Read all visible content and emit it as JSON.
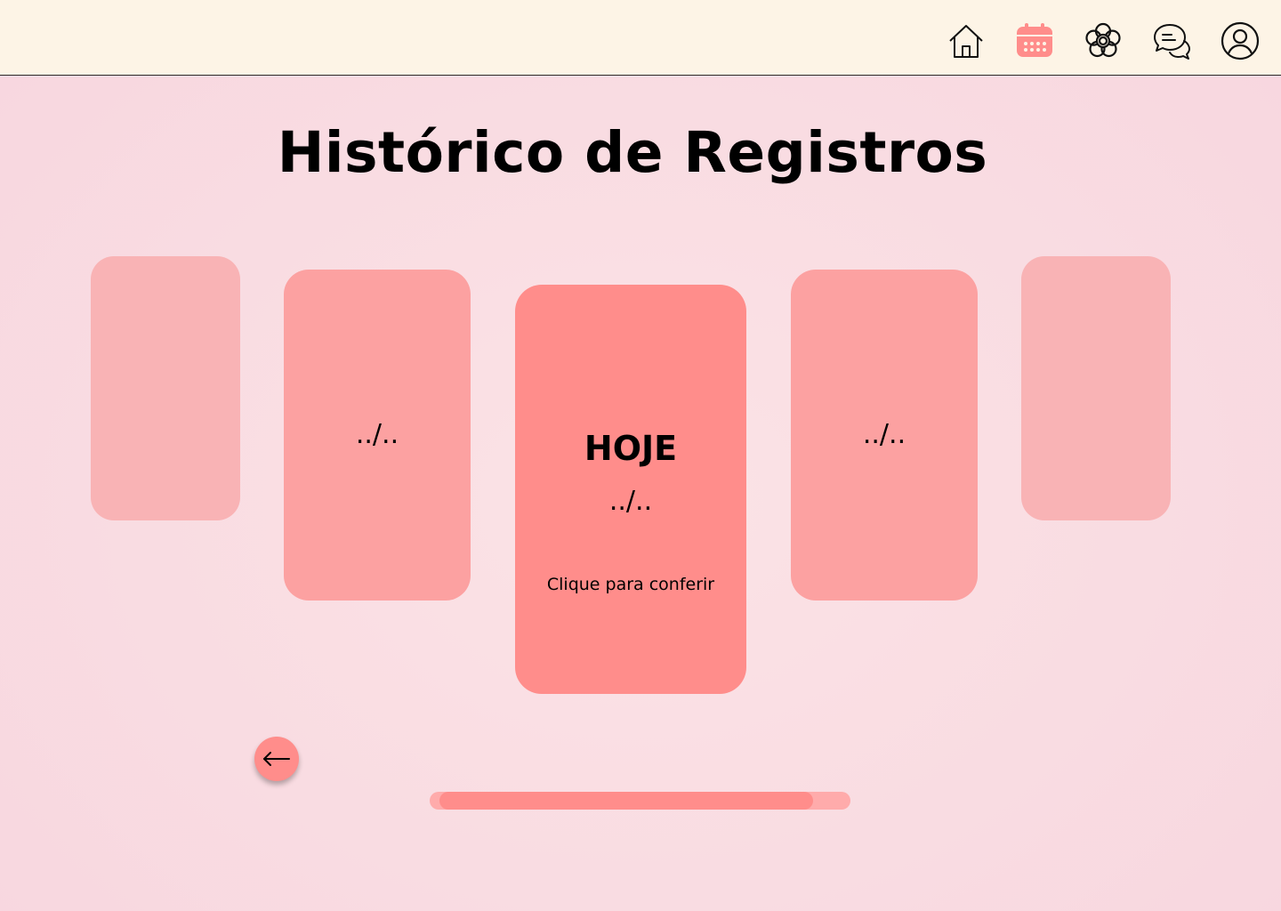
{
  "nav": {
    "items": [
      {
        "icon": "home-icon",
        "active": false
      },
      {
        "icon": "calendar-icon",
        "active": true
      },
      {
        "icon": "flower-icon",
        "active": false
      },
      {
        "icon": "chat-icon",
        "active": false
      },
      {
        "icon": "profile-icon",
        "active": false
      }
    ],
    "active_color": "#ff8d8b"
  },
  "page": {
    "title": "Histórico de Registros"
  },
  "carousel": {
    "prev_card": {
      "date": "../.."
    },
    "current_card": {
      "heading": "HOJE",
      "date": "../..",
      "cta": "Clique para conferir"
    },
    "next_card": {
      "date": "../.."
    },
    "back_icon": "arrow-left-icon",
    "scroll_progress": 0.91
  },
  "colors": {
    "topbar": "#fdf4e6",
    "card_center": "#ff8d8b",
    "card_near": "#fca1a1",
    "card_far": "#f9b3b5"
  }
}
